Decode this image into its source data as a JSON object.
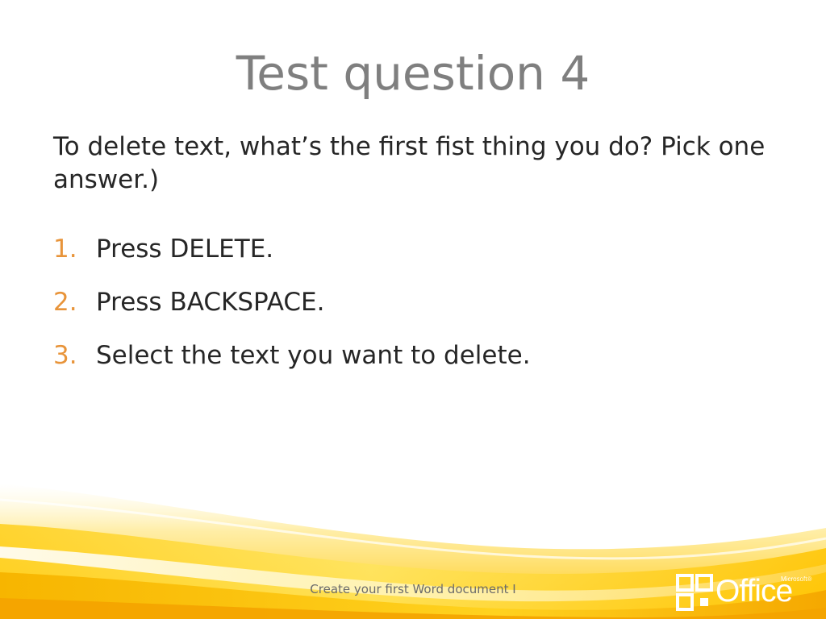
{
  "slide": {
    "title": "Test question 4",
    "question": "To delete text, what’s the first fist thing you do? Pick one answer.)",
    "answers": [
      {
        "number": "1.",
        "text": "Press DELETE."
      },
      {
        "number": "2.",
        "text": "Press BACKSPACE."
      },
      {
        "number": "3.",
        "text": "Select the text you want to delete."
      }
    ],
    "footer": "Create your first Word document I"
  },
  "logo": {
    "wordmark": "Office",
    "microsoft": "Microsoft®",
    "icon": "office-logo-icon"
  },
  "colors": {
    "title": "#7f7f7f",
    "body": "#262626",
    "number_accent": "#e8943a",
    "wave_yellow": "#ffd21f",
    "wave_orange": "#f5a800"
  }
}
